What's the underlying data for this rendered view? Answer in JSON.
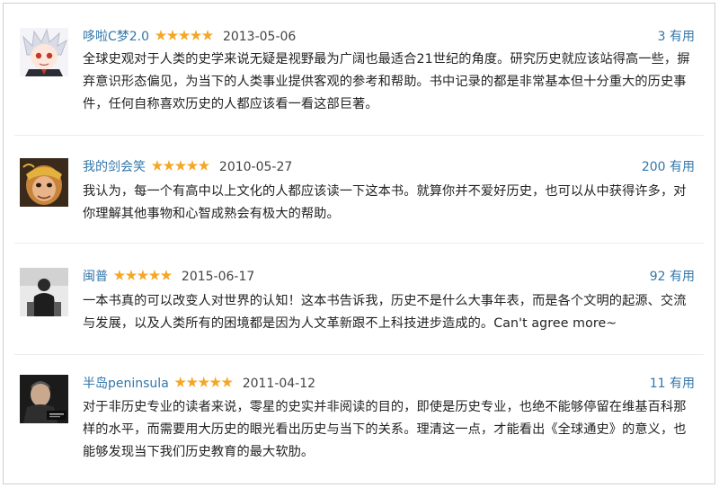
{
  "reviews": [
    {
      "user": "哆啦C梦2.0",
      "rating": 5,
      "date": "2013-05-06",
      "useful_count": "3",
      "useful_label": "有用",
      "avatar_icon": "white-haired-anime-avatar-icon",
      "text": "全球史观对于人类的史学来说无疑是视野最为广阔也最适合21世纪的角度。研究历史就应该站得高一些，摒弃意识形态偏见，为当下的人类事业提供客观的参考和帮助。书中记录的都是非常基本但十分重大的历史事件，任何自称喜欢历史的人都应该看一看这部巨著。"
    },
    {
      "user": "我的剑会笑",
      "rating": 5,
      "date": "2010-05-27",
      "useful_count": "200",
      "useful_label": "有用",
      "avatar_icon": "monkey-king-avatar-icon",
      "text": "我认为，每一个有高中以上文化的人都应该读一下这本书。就算你并不爱好历史，也可以从中获得许多，对你理解其他事物和心智成熟会有极大的帮助。"
    },
    {
      "user": "闽普",
      "rating": 5,
      "date": "2015-06-17",
      "useful_count": "92",
      "useful_label": "有用",
      "avatar_icon": "person-silhouette-avatar-icon",
      "text": "一本书真的可以改变人对世界的认知！这本书告诉我，历史不是什么大事年表，而是各个文明的起源、交流与发展，以及人类所有的困境都是因为人文革新跟不上科技进步造成的。Can't agree more~"
    },
    {
      "user": "半岛peninsula",
      "rating": 5,
      "date": "2011-04-12",
      "useful_count": "11",
      "useful_label": "有用",
      "avatar_icon": "man-portrait-avatar-icon",
      "text": "对于非历史专业的读者来说，零星的史实并非阅读的目的，即使是历史专业，也绝不能够停留在维基百科那样的水平，而需要用大历史的眼光看出历史与当下的关系。理清这一点，才能看出《全球通史》的意义，也能够发现当下我们历史教育的最大软肋。"
    }
  ],
  "colors": {
    "link": "#3377aa",
    "star": "#f5a623",
    "text": "#222222",
    "border": "#cfcfcf"
  }
}
